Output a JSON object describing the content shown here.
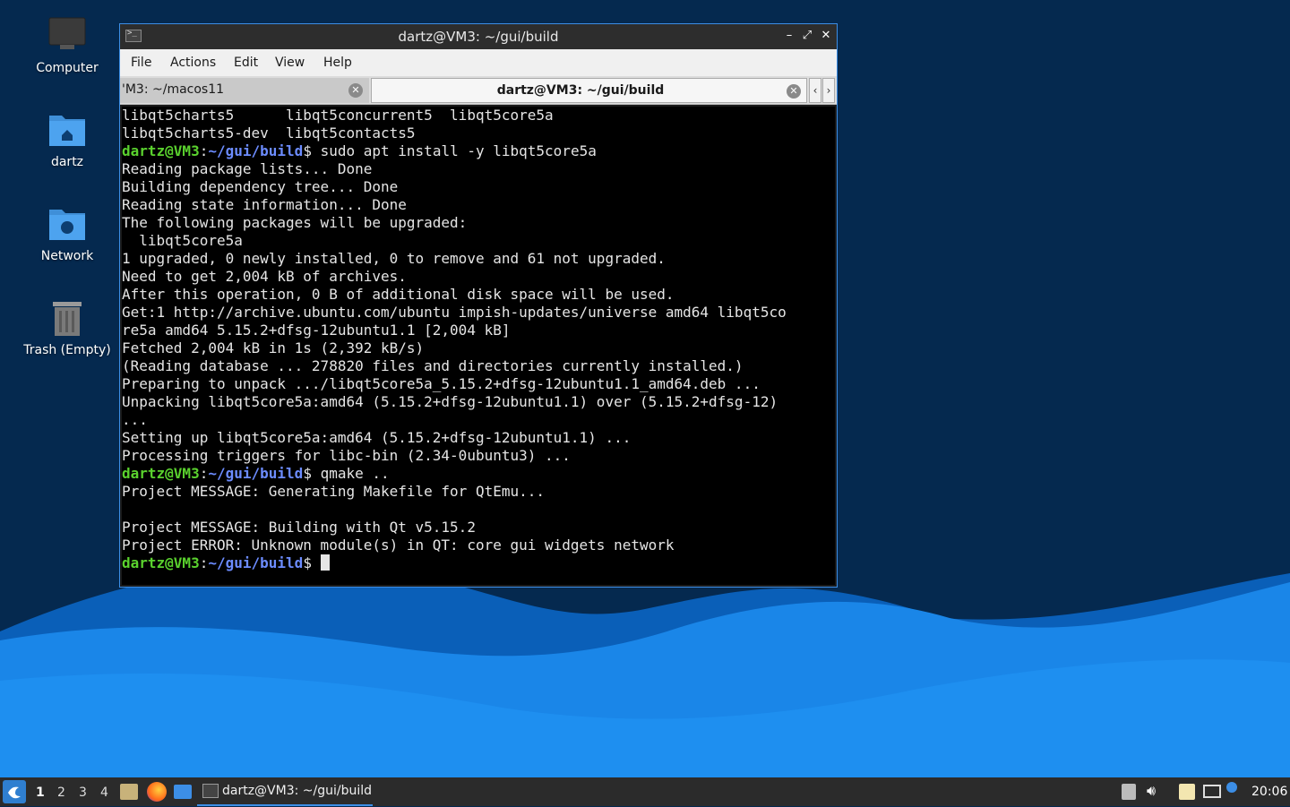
{
  "desktop": {
    "icons": [
      {
        "label": "Computer",
        "icon": "computer-icon"
      },
      {
        "label": "dartz",
        "icon": "home-folder-icon"
      },
      {
        "label": "Network",
        "icon": "network-folder-icon"
      },
      {
        "label": "Trash (Empty)",
        "icon": "trash-icon"
      }
    ]
  },
  "window": {
    "title": "dartz@VM3: ~/gui/build",
    "controls": {
      "minimize": "–",
      "maximize": "⤢",
      "close": "✕"
    },
    "menu": [
      "File",
      "Actions",
      "Edit",
      "View",
      "Help"
    ],
    "tabs": [
      {
        "label": "'M3: ~/macos11",
        "active": false
      },
      {
        "label": "dartz@VM3: ~/gui/build",
        "active": true
      }
    ],
    "tab_scroll": {
      "left": "‹",
      "right": "›"
    }
  },
  "terminal": {
    "prompt_user": "dartz@VM3",
    "prompt_path": "~/gui/build",
    "lines": [
      {
        "text": "libqt5charts5      libqt5concurrent5  libqt5core5a"
      },
      {
        "text": "libqt5charts5-dev  libqt5contacts5"
      },
      {
        "prompt": true,
        "cmd": " sudo apt install -y libqt5core5a"
      },
      {
        "text": "Reading package lists... Done"
      },
      {
        "text": "Building dependency tree... Done"
      },
      {
        "text": "Reading state information... Done"
      },
      {
        "text": "The following packages will be upgraded:"
      },
      {
        "text": "  libqt5core5a"
      },
      {
        "text": "1 upgraded, 0 newly installed, 0 to remove and 61 not upgraded."
      },
      {
        "text": "Need to get 2,004 kB of archives."
      },
      {
        "text": "After this operation, 0 B of additional disk space will be used."
      },
      {
        "text": "Get:1 http://archive.ubuntu.com/ubuntu impish-updates/universe amd64 libqt5co"
      },
      {
        "text": "re5a amd64 5.15.2+dfsg-12ubuntu1.1 [2,004 kB]"
      },
      {
        "text": "Fetched 2,004 kB in 1s (2,392 kB/s)"
      },
      {
        "text": "(Reading database ... 278820 files and directories currently installed.)"
      },
      {
        "text": "Preparing to unpack .../libqt5core5a_5.15.2+dfsg-12ubuntu1.1_amd64.deb ..."
      },
      {
        "text": "Unpacking libqt5core5a:amd64 (5.15.2+dfsg-12ubuntu1.1) over (5.15.2+dfsg-12)"
      },
      {
        "text": "..."
      },
      {
        "text": "Setting up libqt5core5a:amd64 (5.15.2+dfsg-12ubuntu1.1) ..."
      },
      {
        "text": "Processing triggers for libc-bin (2.34-0ubuntu3) ..."
      },
      {
        "prompt": true,
        "cmd": " qmake .."
      },
      {
        "text": "Project MESSAGE: Generating Makefile for QtEmu..."
      },
      {
        "text": ""
      },
      {
        "text": "Project MESSAGE: Building with Qt v5.15.2"
      },
      {
        "text": "Project ERROR: Unknown module(s) in QT: core gui widgets network"
      },
      {
        "prompt": true,
        "cmd": " ",
        "cursor": true
      }
    ]
  },
  "taskbar": {
    "workspaces": [
      "1",
      "2",
      "3",
      "4"
    ],
    "active_workspace": "1",
    "task_label": "dartz@VM3: ~/gui/build",
    "clock": "20:06"
  },
  "colors": {
    "accent": "#3c8ee6",
    "prompt_user": "#5ad12e",
    "prompt_path": "#6c8cff",
    "desktop_bg": "#05294f"
  }
}
